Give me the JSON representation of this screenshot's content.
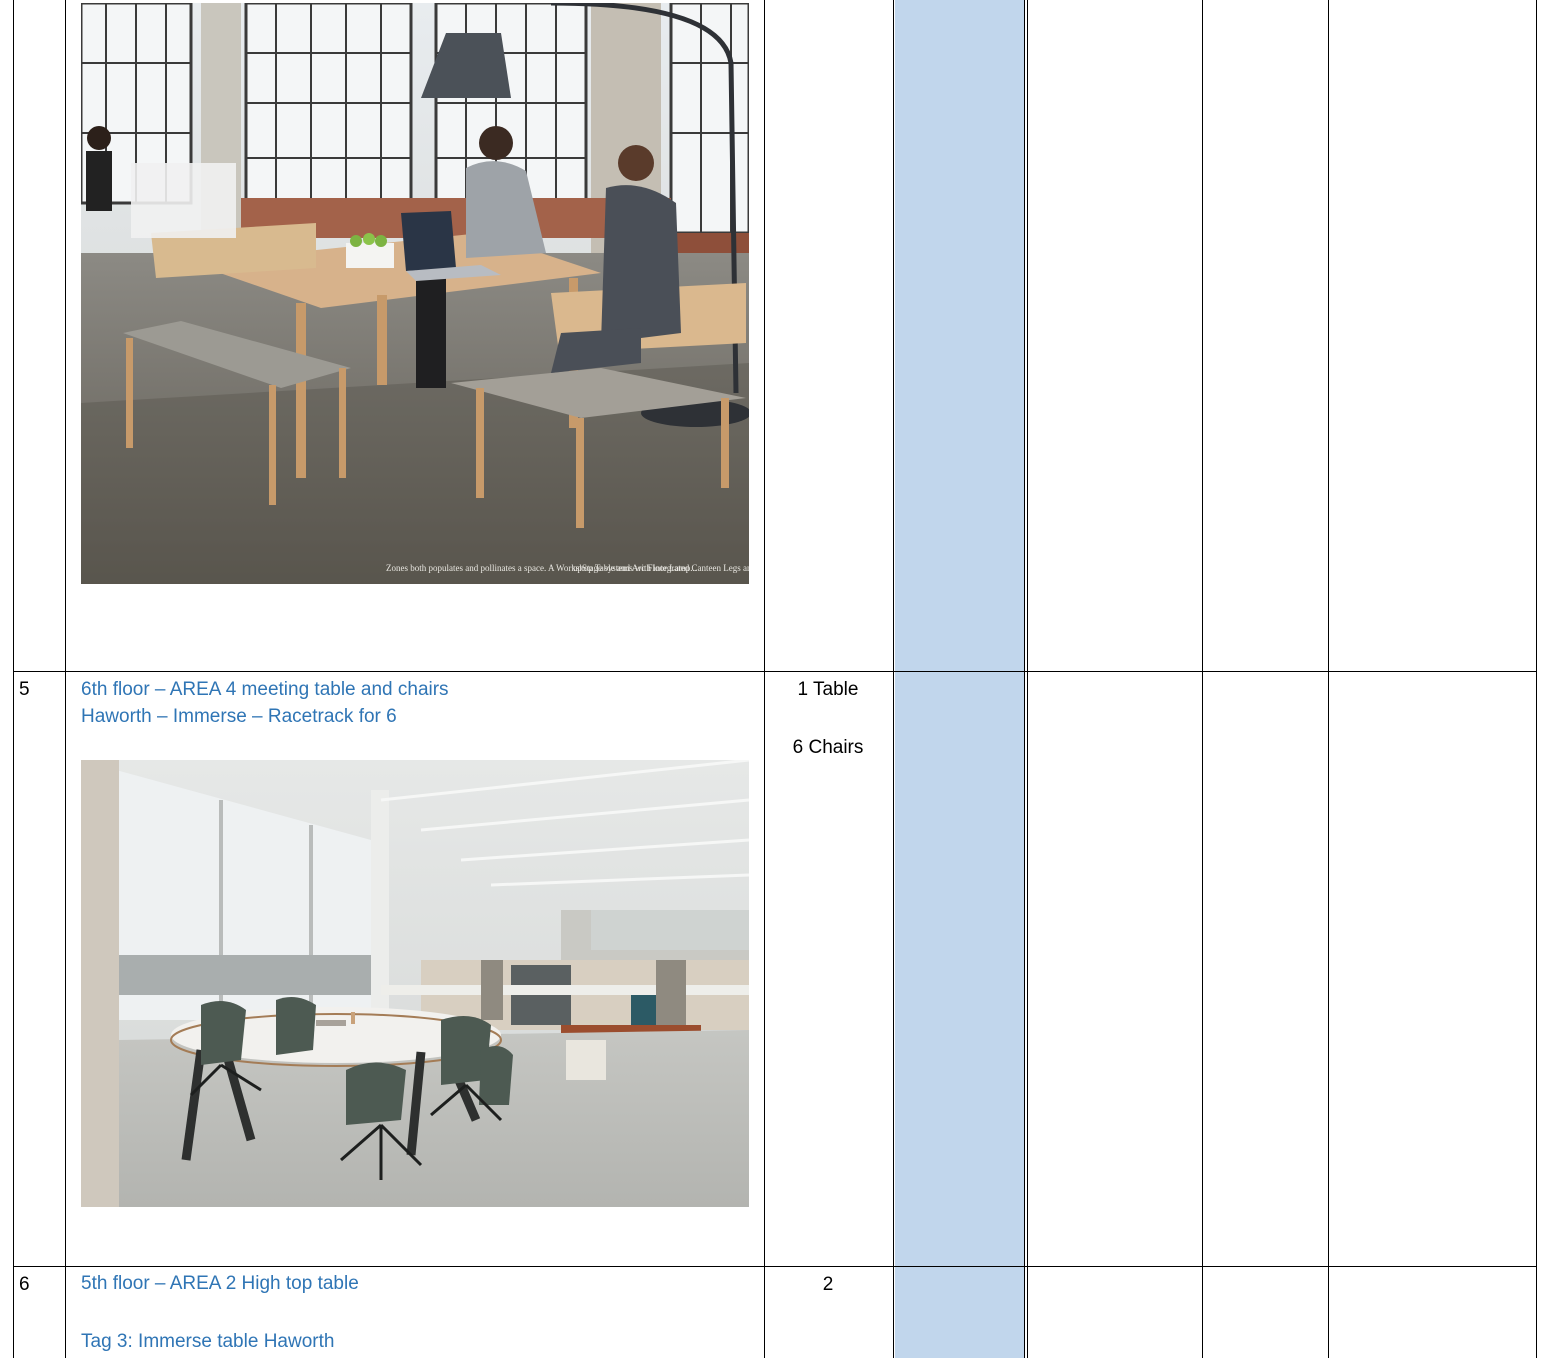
{
  "rows": [
    {
      "photo": {
        "caption_left": "Zones both populates and pollinates a space. A Workshop Table and Arc Floor Lamp...",
        "caption_right": "upStage systems with integrated Canteen Legs and Desk-Edge Screens, which..."
      }
    },
    {
      "number": "5",
      "desc_line1": "6th floor – AREA 4 meeting table and chairs",
      "desc_line2": "Haworth – Immerse – Racetrack for 6",
      "qty_line1": "1 Table",
      "qty_line2": "6 Chairs"
    },
    {
      "number": "6",
      "desc_line1": "5th floor – AREA 2 High top table",
      "desc_line2": "Tag 3: Immerse table Haworth",
      "qty_line1": "2"
    }
  ],
  "colors": {
    "link_blue": "#2f75b5",
    "column_shade": "#c1d6ec",
    "border": "#000000"
  }
}
